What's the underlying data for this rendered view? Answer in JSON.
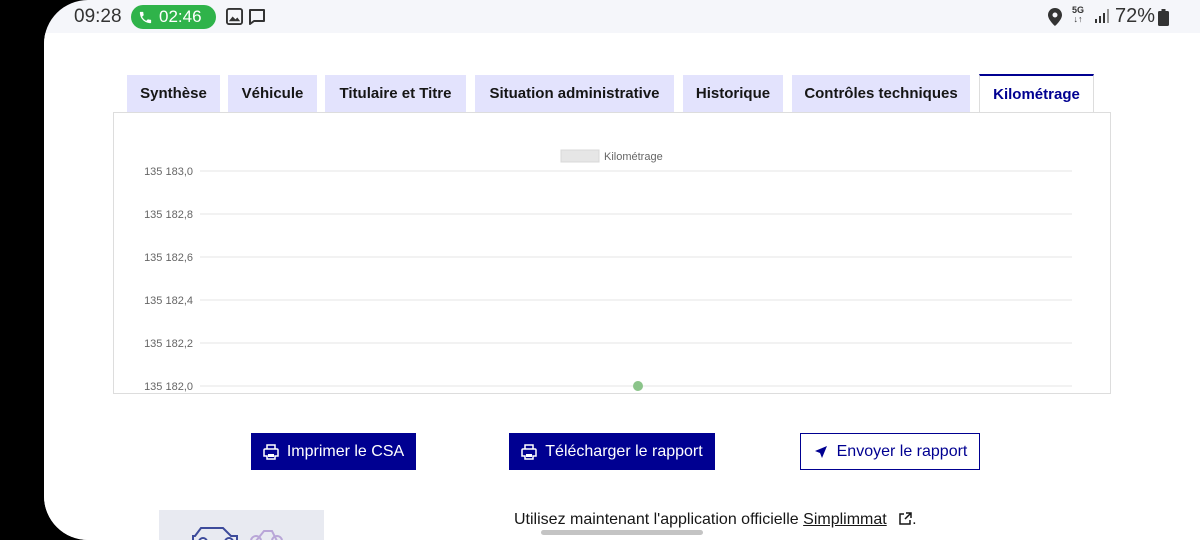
{
  "status_bar": {
    "time": "09:28",
    "call_timer": "02:46",
    "network": "5G",
    "battery": "72%"
  },
  "tabs": [
    {
      "label": "Synthèse",
      "active": false
    },
    {
      "label": "Véhicule",
      "active": false
    },
    {
      "label": "Titulaire et Titre",
      "active": false
    },
    {
      "label": "Situation administrative",
      "active": false
    },
    {
      "label": "Historique",
      "active": false
    },
    {
      "label": "Contrôles techniques",
      "active": false
    },
    {
      "label": "Kilométrage",
      "active": true
    }
  ],
  "chart_data": {
    "type": "scatter",
    "series": [
      {
        "name": "Kilométrage",
        "x": [
          0
        ],
        "y": [
          135182.0
        ],
        "color": "#8bc48a"
      }
    ],
    "ylim": [
      135182.0,
      135183.0
    ],
    "y_ticks": [
      "135 183,0",
      "135 182,8",
      "135 182,6",
      "135 182,4",
      "135 182,2",
      "135 182,0"
    ],
    "y_tick_values": [
      135183.0,
      135182.8,
      135182.6,
      135182.4,
      135182.2,
      135182.0
    ],
    "grid": true,
    "legend_position": "top-center",
    "legend_swatch_color": "#e6e6e6"
  },
  "buttons": {
    "print": "Imprimer le CSA",
    "download": "Télécharger le rapport",
    "send": "Envoyer le rapport"
  },
  "app_promo": {
    "prefix": "Utilisez maintenant l'application officielle ",
    "link": "Simplimmat",
    "suffix": "."
  },
  "colors": {
    "primary": "#000091",
    "tab_bg": "#e3e3fd",
    "call_green": "#2fb34a"
  }
}
